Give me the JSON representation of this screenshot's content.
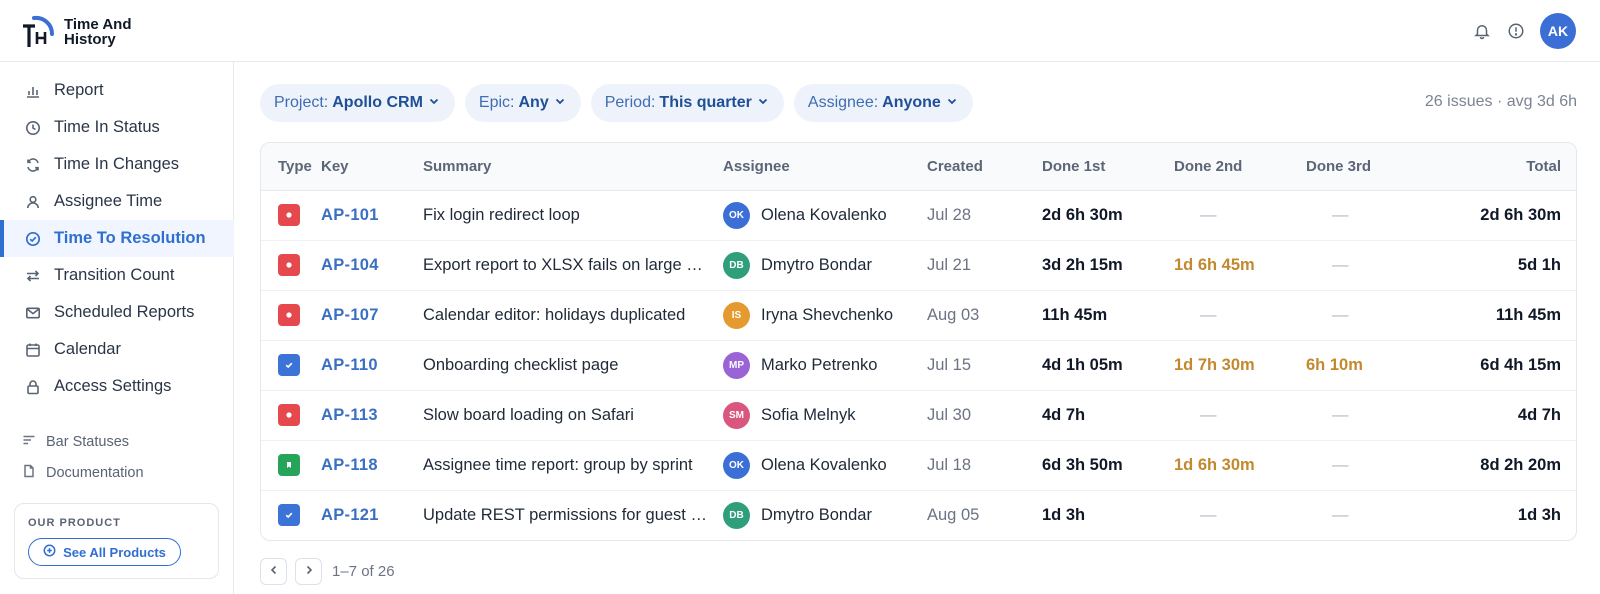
{
  "app": {
    "name_line1": "Time And",
    "name_line2": "History",
    "logo_letters": "TH"
  },
  "header": {
    "user_initials": "AK",
    "icons": [
      "bell-icon",
      "help-icon"
    ]
  },
  "sidebar": {
    "items": [
      {
        "label": "Report",
        "icon": "bar-chart-icon",
        "active": false
      },
      {
        "label": "Time In Status",
        "icon": "clock-icon",
        "active": false
      },
      {
        "label": "Time In Changes",
        "icon": "refresh-icon",
        "active": false
      },
      {
        "label": "Assignee Time",
        "icon": "user-icon",
        "active": false
      },
      {
        "label": "Time To Resolution",
        "icon": "check-circle-icon",
        "active": true
      },
      {
        "label": "Transition Count",
        "icon": "arrows-icon",
        "active": false
      },
      {
        "label": "Scheduled Reports",
        "icon": "mail-icon",
        "active": false
      },
      {
        "label": "Calendar",
        "icon": "calendar-icon",
        "active": false
      },
      {
        "label": "Access Settings",
        "icon": "lock-icon",
        "active": false
      }
    ],
    "secondary": [
      {
        "label": "Bar Statuses",
        "icon": "bars-icon"
      },
      {
        "label": "Documentation",
        "icon": "document-icon"
      }
    ],
    "product": {
      "label": "OUR PRODUCT",
      "button": "See All Products"
    }
  },
  "filters": [
    {
      "label": "Project:",
      "value": "Apollo CRM"
    },
    {
      "label": "Epic:",
      "value": "Any"
    },
    {
      "label": "Period:",
      "value": "This quarter"
    },
    {
      "label": "Assignee:",
      "value": "Anyone"
    }
  ],
  "summary": "26 issues · avg 3d 6h",
  "table": {
    "columns": [
      "Type",
      "Key",
      "Summary",
      "Assignee",
      "Created",
      "Done 1st",
      "Done 2nd",
      "Done 3rd",
      "Total"
    ],
    "rows": [
      {
        "type": "bug",
        "key": "AP-101",
        "summary": "Fix login redirect loop",
        "initials": "OK",
        "avatar_color": "#3b6fd6",
        "assignee": "Olena Kovalenko",
        "created": "Jul 28",
        "d1": "2d 6h 30m",
        "d2": "—",
        "d3": "—",
        "total": "2d 6h 30m"
      },
      {
        "type": "bug",
        "key": "AP-104",
        "summary": "Export report to XLSX fails on large projects",
        "initials": "DB",
        "avatar_color": "#2f9e7a",
        "assignee": "Dmytro Bondar",
        "created": "Jul 21",
        "d1": "3d 2h 15m",
        "d2": "1d 6h 45m",
        "d3": "—",
        "total": "5d 1h"
      },
      {
        "type": "bug",
        "key": "AP-107",
        "summary": "Calendar editor: holidays duplicated",
        "initials": "IS",
        "avatar_color": "#e59a2f",
        "assignee": "Iryna Shevchenko",
        "created": "Aug 03",
        "d1": "11h 45m",
        "d2": "—",
        "d3": "—",
        "total": "11h 45m"
      },
      {
        "type": "task",
        "key": "AP-110",
        "summary": "Onboarding checklist page",
        "initials": "MP",
        "avatar_color": "#9a64d6",
        "assignee": "Marko Petrenko",
        "created": "Jul 15",
        "d1": "4d 1h 05m",
        "d2": "1d 7h 30m",
        "d3": "6h 10m",
        "total": "6d 4h 15m"
      },
      {
        "type": "bug",
        "key": "AP-113",
        "summary": "Slow board loading on Safari",
        "initials": "SM",
        "avatar_color": "#d9577e",
        "assignee": "Sofia Melnyk",
        "created": "Jul 30",
        "d1": "4d 7h",
        "d2": "—",
        "d3": "—",
        "total": "4d 7h"
      },
      {
        "type": "story",
        "key": "AP-118",
        "summary": "Assignee time report: group by sprint",
        "initials": "OK",
        "avatar_color": "#3b6fd6",
        "assignee": "Olena Kovalenko",
        "created": "Jul 18",
        "d1": "6d 3h 50m",
        "d2": "1d 6h 30m",
        "d3": "—",
        "total": "8d 2h 20m"
      },
      {
        "type": "task",
        "key": "AP-121",
        "summary": "Update REST permissions for guest users",
        "initials": "DB",
        "avatar_color": "#2f9e7a",
        "assignee": "Dmytro Bondar",
        "created": "Aug 05",
        "d1": "1d 3h",
        "d2": "—",
        "d3": "—",
        "total": "1d 3h"
      }
    ]
  },
  "type_colors": {
    "bug": "#e5484d",
    "task": "#3b73d6",
    "story": "#26a45a"
  },
  "warn_color": "#c2892e",
  "pagination": {
    "text": "1–7 of 26"
  }
}
